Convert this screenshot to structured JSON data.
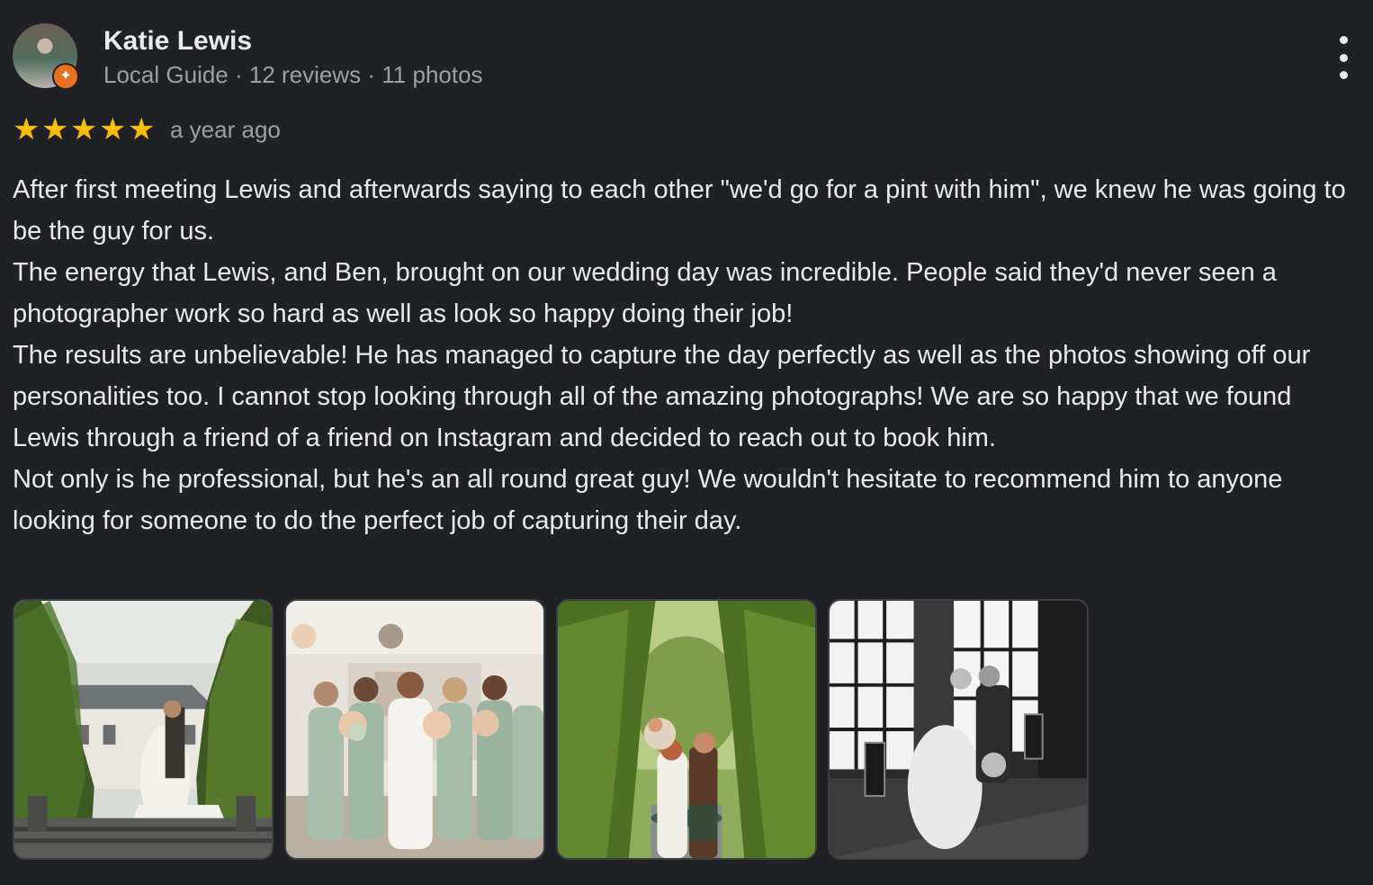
{
  "author": {
    "name": "Katie Lewis",
    "avatar_icon": "user-avatar",
    "badge_icon": "local-guide-badge-icon",
    "meta": [
      "Local Guide",
      " · ",
      "12 reviews",
      " · ",
      "11 photos"
    ]
  },
  "menu_icon": "more-vert-icon",
  "rating": {
    "stars": 5,
    "star_glyph": "★",
    "star_color": "#fbbc04",
    "date": "a year ago"
  },
  "review": {
    "paragraphs": [
      "After first meeting Lewis and afterwards saying to each other \"we'd go for a pint with him\", we knew he was going to be the guy for us.",
      "The energy that Lewis, and Ben, brought on our wedding day was incredible. People said they'd never seen a photographer work so hard as well as look so happy doing their job!",
      "The results are unbelievable! He has managed to capture the day perfectly as well as the photos showing off our personalities too. I cannot stop looking through all of the amazing photographs! We are so happy that we found Lewis through a friend of a friend on Instagram and decided to reach out to book him.",
      "Not only is he professional, but he's an all round great guy! We wouldn't hesitate to recommend him to anyone looking for someone to do the perfect job of capturing their day."
    ]
  },
  "photos": [
    {
      "subject": "couple-in-garden-avenue-photo"
    },
    {
      "subject": "bride-and-bridesmaids-photo"
    },
    {
      "subject": "couple-kissing-tree-avenue-photo"
    },
    {
      "subject": "black-and-white-couple-window-photo"
    }
  ],
  "colors": {
    "background": "#202124",
    "primary_text": "#e8eaed",
    "secondary_text": "#9aa0a6",
    "badge": "#e8711e"
  }
}
